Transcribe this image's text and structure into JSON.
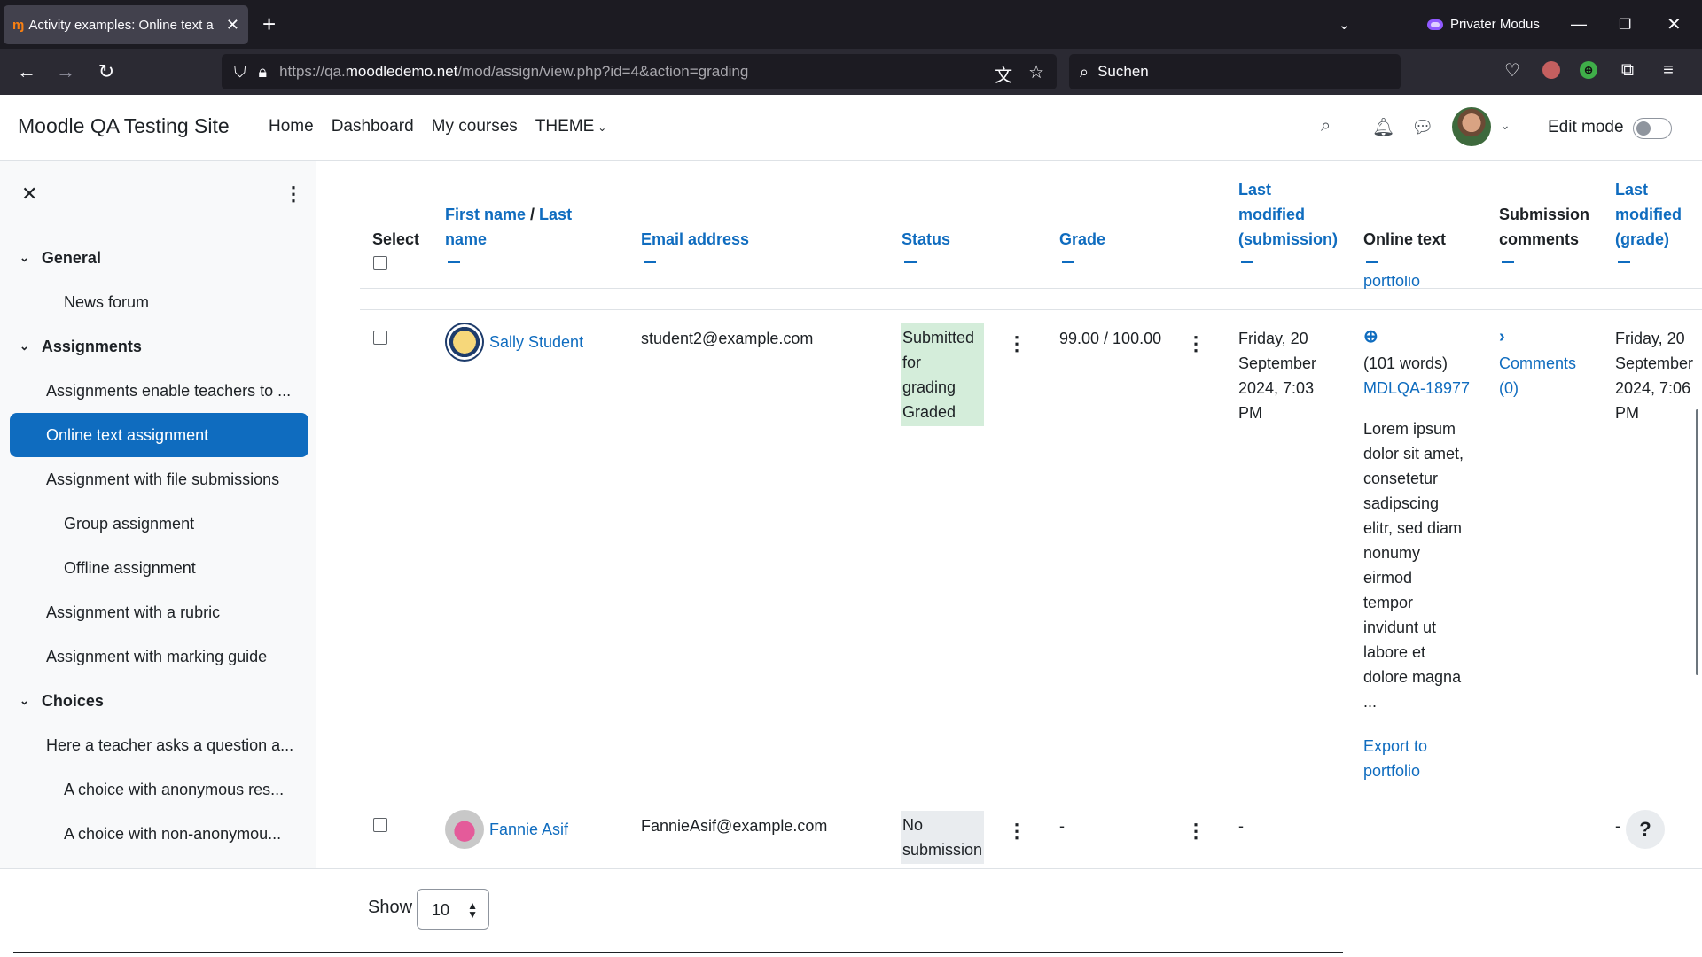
{
  "browser": {
    "tab_title": "Activity examples: Online text a",
    "tab_close": "✕",
    "private_mode": "Privater Modus",
    "url_prefix": "https://qa.",
    "url_domain": "moodledemo.net",
    "url_path": "/mod/assign/view.php?id=4&action=grading",
    "search_placeholder": "Suchen"
  },
  "header": {
    "site_name": "Moodle QA Testing Site",
    "nav": [
      "Home",
      "Dashboard",
      "My courses",
      "THEME"
    ],
    "edit_mode_label": "Edit mode"
  },
  "drawer": {
    "items": [
      {
        "label": "General",
        "type": "section"
      },
      {
        "label": "News forum",
        "type": "l2"
      },
      {
        "label": "Assignments",
        "type": "section"
      },
      {
        "label": "Assignments enable teachers to ...",
        "type": "l1"
      },
      {
        "label": "Online text assignment",
        "type": "active"
      },
      {
        "label": "Assignment with file submissions",
        "type": "l1"
      },
      {
        "label": "Group assignment",
        "type": "l2"
      },
      {
        "label": "Offline assignment",
        "type": "l2"
      },
      {
        "label": "Assignment with a rubric",
        "type": "l1"
      },
      {
        "label": "Assignment with marking guide",
        "type": "l1"
      },
      {
        "label": "Choices",
        "type": "section"
      },
      {
        "label": "Here a teacher asks a question a...",
        "type": "l1"
      },
      {
        "label": "A choice with anonymous res...",
        "type": "l2"
      },
      {
        "label": "A choice with non-anonymou...",
        "type": "l2"
      }
    ]
  },
  "table": {
    "headers": {
      "select": "Select",
      "first_name": "First name",
      "name_sep": " / ",
      "last_name": "Last",
      "last_name2": "name",
      "email": "Email address",
      "status": "Status",
      "grade": "Grade",
      "last_mod_sub_1": "Last",
      "last_mod_sub_2": "modified",
      "last_mod_sub_3": "(submission)",
      "online_text": "Online text",
      "sub_comments_1": "Submission",
      "sub_comments_2": "comments",
      "last_mod_grade_1": "Last",
      "last_mod_grade_2": "modified",
      "last_mod_grade_3": "(grade)"
    },
    "partial_row_text": "portfolio",
    "rows": [
      {
        "name": "Sally Student",
        "email": "student2@example.com",
        "status_lines": [
          "Submitted",
          "for",
          "grading",
          "Graded"
        ],
        "grade": "99.00 / 100.00",
        "last_modified_submission": [
          "Friday, 20",
          "September",
          "2024, 7:03",
          "PM"
        ],
        "online_text_words": "(101 words)",
        "online_text_link": "MDLQA-18977",
        "online_text_body": [
          "Lorem ipsum",
          "dolor sit amet,",
          "consetetur",
          "sadipscing",
          "elitr, sed diam",
          "nonumy",
          "eirmod",
          "tempor",
          "invidunt ut",
          "labore et",
          "dolore magna",
          "..."
        ],
        "export_1": "Export to",
        "export_2": "portfolio",
        "comments_1": "Comments",
        "comments_2": "(0)",
        "last_modified_grade": [
          "Friday, 20",
          "September",
          "2024, 7:06",
          "PM"
        ]
      },
      {
        "name": "Fannie Asif",
        "email": "FannieAsif@example.com",
        "status_lines": [
          "No",
          "submission"
        ],
        "grade": "-",
        "last_modified_submission": "-",
        "last_modified_grade": "-"
      }
    ]
  },
  "footer": {
    "show_label": "Show",
    "per_page": "10"
  },
  "help": "?"
}
